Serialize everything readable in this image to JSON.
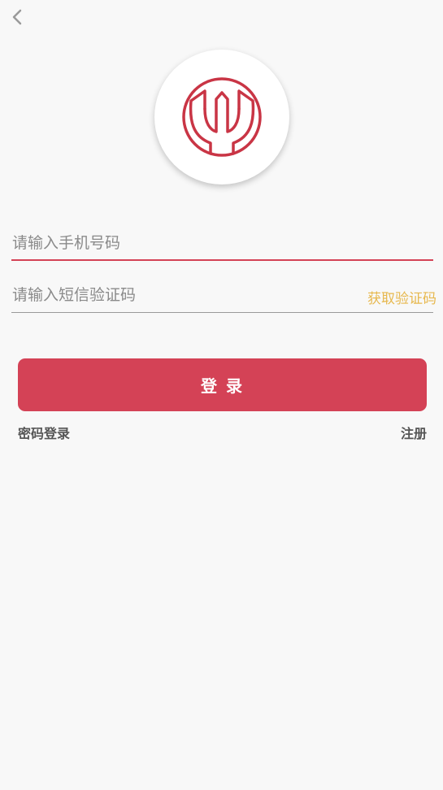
{
  "nav": {
    "back_icon": "chevron-left-icon"
  },
  "logo": {
    "icon": "tulip-fork-logo",
    "color": "#c93545"
  },
  "form": {
    "phone_placeholder": "请输入手机号码",
    "phone_value": "",
    "code_placeholder": "请输入短信验证码",
    "code_value": "",
    "get_code_label": "获取验证码"
  },
  "actions": {
    "login_label": "登 录",
    "password_login_label": "密码登录",
    "register_label": "注册"
  },
  "colors": {
    "primary": "#d44256",
    "accent": "#e7b84e",
    "background": "#f8f8f8"
  }
}
